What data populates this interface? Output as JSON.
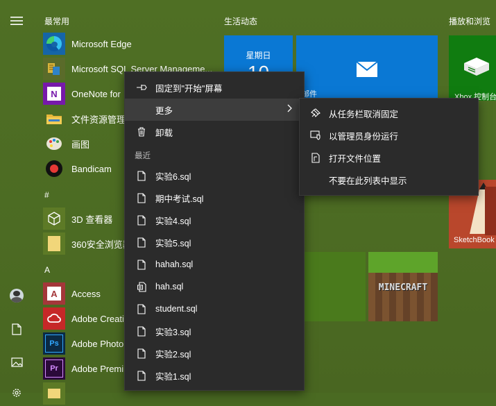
{
  "start_menu": {
    "groups": {
      "most_used": "最常用",
      "hash": "#",
      "a": "A"
    },
    "apps": [
      {
        "label": "Microsoft Edge"
      },
      {
        "label": "Microsoft SQL Server Manageme..."
      },
      {
        "label": "OneNote for"
      },
      {
        "label": "文件资源管理器"
      },
      {
        "label": "画图"
      },
      {
        "label": "Bandicam"
      },
      {
        "label": "3D 查看器"
      },
      {
        "label": "360安全浏览器"
      },
      {
        "label": "Access"
      },
      {
        "label": "Adobe Creati"
      },
      {
        "label": "Adobe Photo"
      },
      {
        "label": "Adobe Premi"
      }
    ]
  },
  "tiles": {
    "section_life": "生活动态",
    "section_play": "播放和浏览",
    "calendar_day": "星期日",
    "calendar_date": "10",
    "mail_label": "邮件",
    "xbox_label": "Xbox 控制台",
    "sketchbook_label": "SketchBook",
    "minecraft_label": "MINECRAFT"
  },
  "context_menu": {
    "pin": "固定到\"开始\"屏幕",
    "more": "更多",
    "uninstall": "卸载",
    "recent_header": "最近",
    "recent_files": [
      "实验6.sql",
      "期中考试.sql",
      "实验4.sql",
      "实验5.sql",
      "hahah.sql",
      "hah.sql",
      "student.sql",
      "实验3.sql",
      "实验2.sql",
      "实验1.sql"
    ]
  },
  "submenu": {
    "unpin_taskbar": "从任务栏取消固定",
    "run_as_admin": "以管理员身份运行",
    "open_location": "打开文件位置",
    "hide_from_list": "不要在此列表中显示"
  },
  "colors": {
    "accent_blue": "#0a78d4",
    "menu_bg": "#2b2b2b",
    "tile_green": "#4a7a1c"
  }
}
